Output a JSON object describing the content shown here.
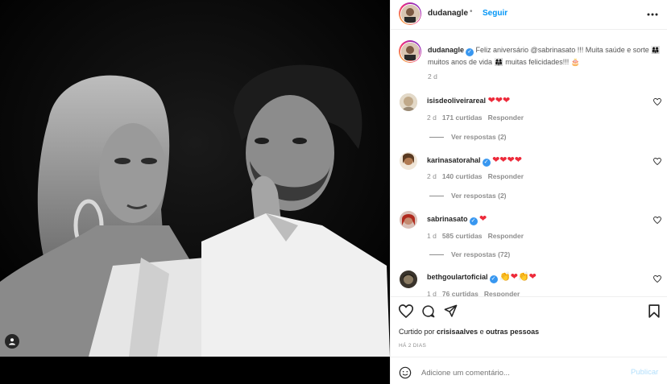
{
  "post": {
    "username": "dudanagle",
    "follow_label": "Seguir",
    "more_icon": "more-horizontal-icon",
    "caption": {
      "text": "Feliz aniversário @sabrinasato !!! Muita saúde e sorte 👩‍👩‍👧 muitos anos de vida 👩‍👩‍👧 muitas felicidades!!! 🎂",
      "time": "2 d"
    }
  },
  "comments": [
    {
      "username": "isisdeoliveirareal",
      "verified": false,
      "text": "❤❤❤",
      "time": "2 d",
      "likes": "171 curtidas",
      "reply_label": "Responder",
      "view_replies": "Ver respostas (2)"
    },
    {
      "username": "karinasatorahal",
      "verified": true,
      "text": "❤❤❤❤",
      "time": "2 d",
      "likes": "140 curtidas",
      "reply_label": "Responder",
      "view_replies": "Ver respostas (2)"
    },
    {
      "username": "sabrinasato",
      "verified": true,
      "text": "❤",
      "time": "1 d",
      "likes": "585 curtidas",
      "reply_label": "Responder",
      "view_replies": "Ver respostas (72)"
    },
    {
      "username": "bethgoulartoficial",
      "verified": true,
      "text": "👏❤👏❤",
      "time": "1 d",
      "likes": "76 curtidas",
      "reply_label": "Responder",
      "view_replies": ""
    }
  ],
  "actions": {
    "liked_by_prefix": "Curtido por",
    "liked_by_user": "crisisaalves",
    "liked_by_and": "e",
    "liked_by_others": "outras pessoas",
    "date": "HÁ 2 DIAS"
  },
  "composer": {
    "placeholder": "Adicione um comentário...",
    "publish_label": "Publicar"
  },
  "colors": {
    "accent": "#0095f6",
    "verified": "#3897f0",
    "heart": "#ed2a3a",
    "muted": "#8e8e8e"
  }
}
